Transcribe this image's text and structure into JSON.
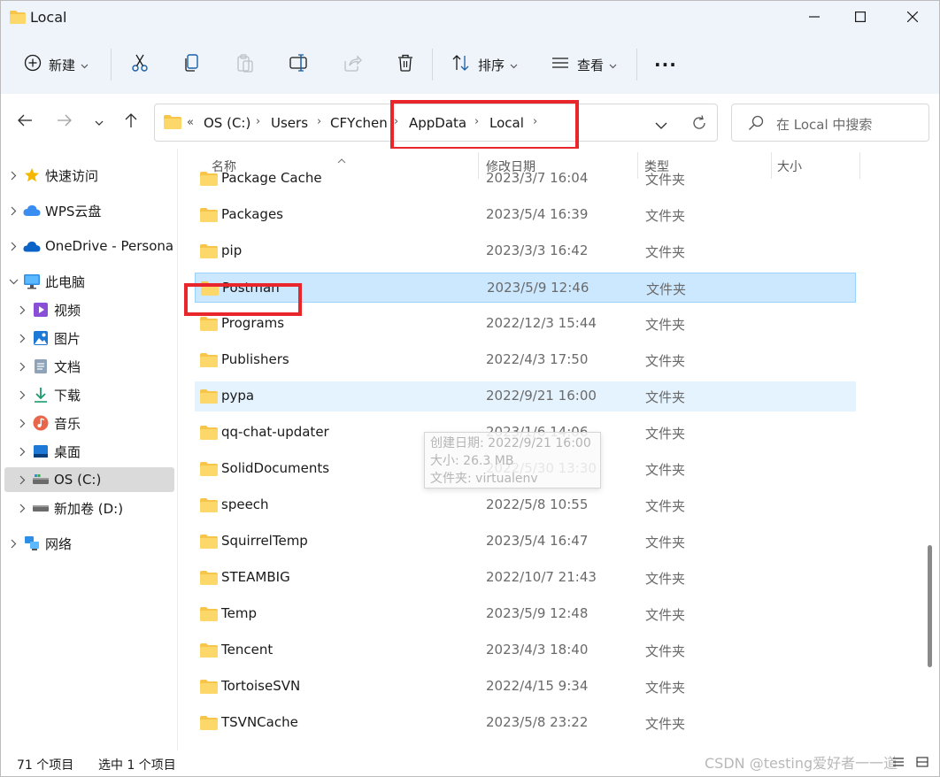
{
  "window": {
    "title": "Local"
  },
  "toolbar": {
    "new_label": "新建",
    "sort_label": "排序",
    "view_label": "查看",
    "more_label": "···"
  },
  "address": {
    "overflow": "«",
    "crumbs": [
      "OS (C:)",
      "Users",
      "CFYchen",
      "AppData",
      "Local"
    ]
  },
  "search": {
    "placeholder": "在 Local 中搜索"
  },
  "sidebar": {
    "items": [
      {
        "label": "快速访问",
        "icon": "star-icon"
      },
      {
        "label": "WPS云盘",
        "icon": "cloud-icon"
      },
      {
        "label": "OneDrive - Persona",
        "icon": "onedrive-icon"
      },
      {
        "label": "此电脑",
        "icon": "computer-icon"
      },
      {
        "label": "视频",
        "icon": "video-icon"
      },
      {
        "label": "图片",
        "icon": "pictures-icon"
      },
      {
        "label": "文档",
        "icon": "documents-icon"
      },
      {
        "label": "下载",
        "icon": "download-icon"
      },
      {
        "label": "音乐",
        "icon": "music-icon"
      },
      {
        "label": "桌面",
        "icon": "desktop-icon"
      },
      {
        "label": "OS (C:)",
        "icon": "drive-icon"
      },
      {
        "label": "新加卷 (D:)",
        "icon": "drive-icon"
      },
      {
        "label": "网络",
        "icon": "network-icon"
      }
    ]
  },
  "columns": {
    "name": "名称",
    "modified": "修改日期",
    "type": "类型",
    "size": "大小"
  },
  "files": [
    {
      "name": "Package Cache",
      "modified": "2023/3/7 16:04",
      "type": "文件夹"
    },
    {
      "name": "Packages",
      "modified": "2023/5/4 16:39",
      "type": "文件夹"
    },
    {
      "name": "pip",
      "modified": "2023/3/3 16:42",
      "type": "文件夹"
    },
    {
      "name": "Postman",
      "modified": "2023/5/9 12:46",
      "type": "文件夹"
    },
    {
      "name": "Programs",
      "modified": "2022/12/3 15:44",
      "type": "文件夹"
    },
    {
      "name": "Publishers",
      "modified": "2022/4/3 17:50",
      "type": "文件夹"
    },
    {
      "name": "pypa",
      "modified": "2022/9/21 16:00",
      "type": "文件夹"
    },
    {
      "name": "qq-chat-updater",
      "modified": "2023/1/6 14:06",
      "type": "文件夹"
    },
    {
      "name": "SolidDocuments",
      "modified": "2022/5/30 13:30",
      "type": "文件夹"
    },
    {
      "name": "speech",
      "modified": "2022/5/8 10:55",
      "type": "文件夹"
    },
    {
      "name": "SquirrelTemp",
      "modified": "2023/5/4 16:47",
      "type": "文件夹"
    },
    {
      "name": "STEAMBIG",
      "modified": "2022/10/7 21:43",
      "type": "文件夹"
    },
    {
      "name": "Temp",
      "modified": "2023/5/9 12:48",
      "type": "文件夹"
    },
    {
      "name": "Tencent",
      "modified": "2023/4/3 18:40",
      "type": "文件夹"
    },
    {
      "name": "TortoiseSVN",
      "modified": "2022/4/15 9:34",
      "type": "文件夹"
    },
    {
      "name": "TSVNCache",
      "modified": "2023/5/8 23:22",
      "type": "文件夹"
    }
  ],
  "tooltip": {
    "line1": "创建日期: 2022/9/21 16:00",
    "line2": "大小: 26.3 MB",
    "line3": "文件夹: virtualenv"
  },
  "status": {
    "count": "71 个项目",
    "selected": "选中 1 个项目"
  },
  "watermark": "CSDN @testing爱好者一一道",
  "colors": {
    "selection": "#cce8ff",
    "hover": "#e5f3ff",
    "annotation": "#e8262b",
    "folder": "#f6c54a"
  }
}
